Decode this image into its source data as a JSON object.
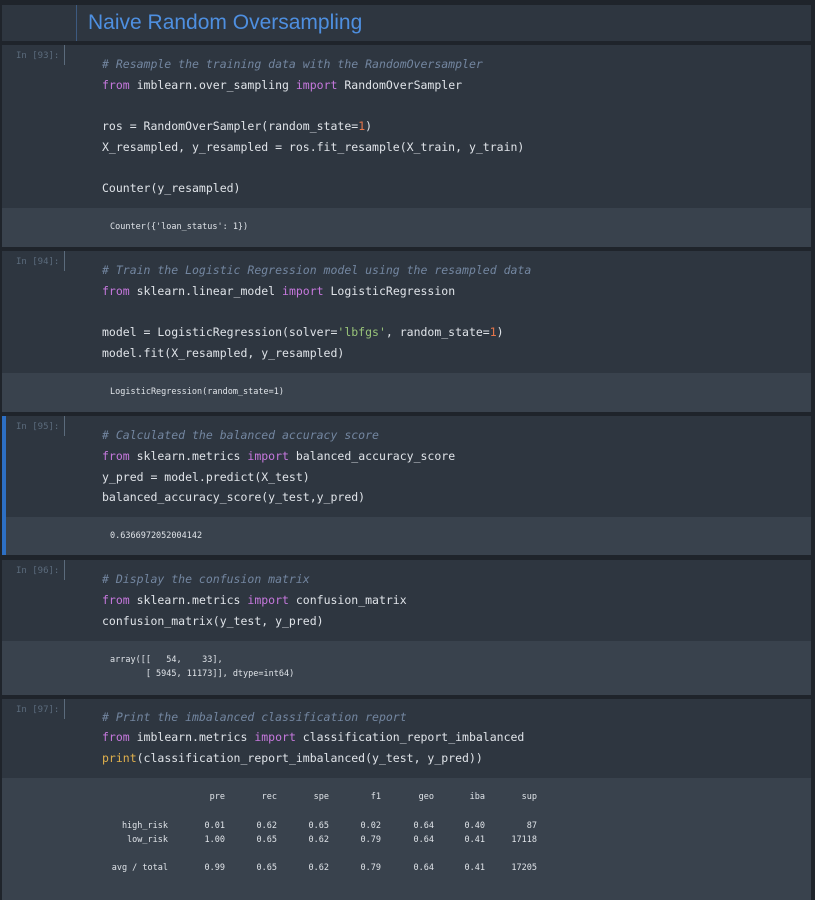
{
  "title": "Naive Random Oversampling",
  "cells": [
    {
      "prompt": "In [93]:",
      "code": [
        "# Resample the training data with the RandomOversampler",
        "from imblearn.over_sampling import RandomOverSampler",
        "",
        "ros = RandomOverSampler(random_state=1)",
        "X_resampled, y_resampled = ros.fit_resample(X_train, y_train)",
        "",
        "Counter(y_resampled)"
      ],
      "output": [
        "Counter({'loan_status': 1})"
      ]
    },
    {
      "prompt": "In [94]:",
      "code": [
        "# Train the Logistic Regression model using the resampled data",
        "from sklearn.linear_model import LogisticRegression",
        "",
        "model = LogisticRegression(solver='lbfgs', random_state=1)",
        "model.fit(X_resampled, y_resampled)"
      ],
      "output": [
        "LogisticRegression(random_state=1)"
      ]
    },
    {
      "prompt": "In [95]:",
      "code": [
        "# Calculated the balanced accuracy score",
        "from sklearn.metrics import balanced_accuracy_score",
        "y_pred = model.predict(X_test)",
        "balanced_accuracy_score(y_test,y_pred)"
      ],
      "output": [
        "0.6366972052004142"
      ]
    },
    {
      "prompt": "In [96]:",
      "code": [
        "# Display the confusion matrix",
        "from sklearn.metrics import confusion_matrix",
        "confusion_matrix(y_test, y_pred)"
      ],
      "output": [
        "array([[   54,    33],",
        "       [ 5945, 11173]], dtype=int64)"
      ]
    },
    {
      "prompt": "In [97]:",
      "code": [
        "# Print the imbalanced classification report",
        "from imblearn.metrics import classification_report_imbalanced",
        "print(classification_report_imbalanced(y_test, y_pred))"
      ]
    }
  ],
  "report": {
    "headers": [
      "pre",
      "rec",
      "spe",
      "f1",
      "geo",
      "iba",
      "sup"
    ],
    "rows": [
      {
        "label": "high_risk",
        "values": [
          "0.01",
          "0.62",
          "0.65",
          "0.02",
          "0.64",
          "0.40",
          "87"
        ]
      },
      {
        "label": "low_risk",
        "values": [
          "1.00",
          "0.65",
          "0.62",
          "0.79",
          "0.64",
          "0.41",
          "17118"
        ]
      },
      {
        "label": "avg / total",
        "values": [
          "0.99",
          "0.65",
          "0.62",
          "0.79",
          "0.64",
          "0.41",
          "17205"
        ]
      }
    ]
  },
  "colors": {
    "background": "#1f242b",
    "cell": "#2e3640",
    "output": "#39424d",
    "title": "#4e8fe0",
    "comment": "#7386a0",
    "keyword": "#c678dd",
    "number": "#e8764a",
    "string": "#98c379",
    "active_bar": "#2d6fc4"
  }
}
